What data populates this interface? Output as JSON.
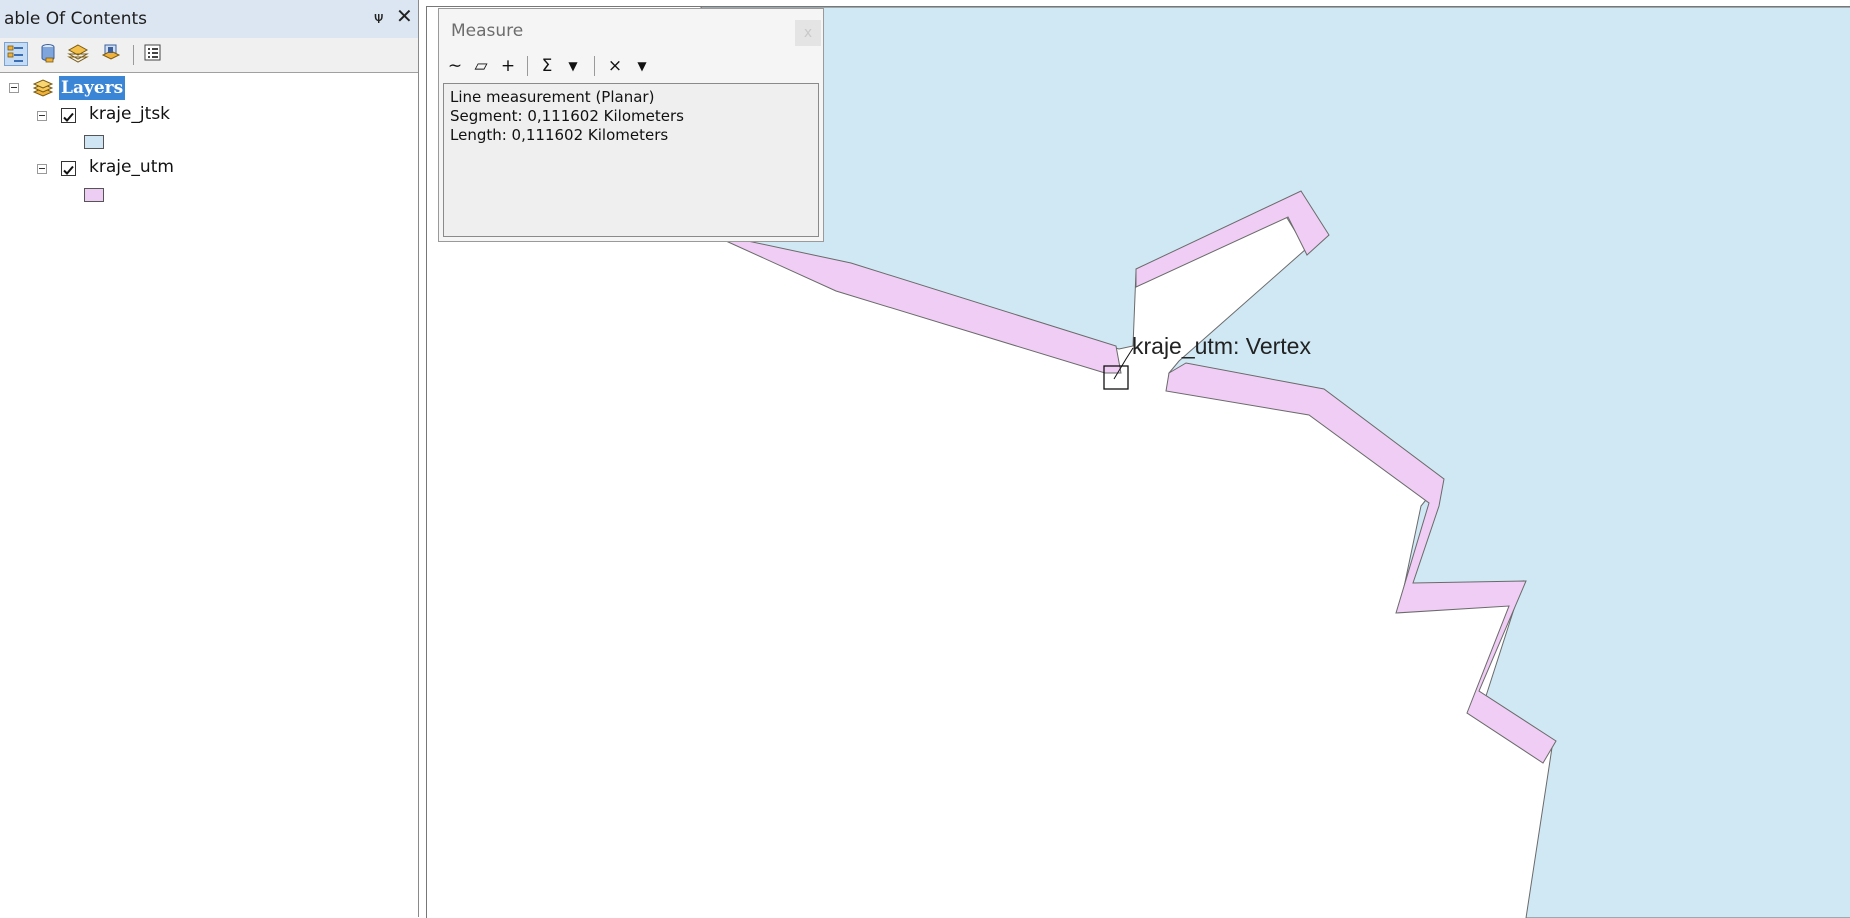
{
  "toc": {
    "title": "able Of Contents",
    "pin_glyph": "ᴪ",
    "close_glyph": "✕",
    "toolbar": {
      "buttons": [
        "list-by-drawing-order-icon",
        "list-by-source-icon",
        "list-by-visibility-icon",
        "list-by-selection-icon",
        "options-icon"
      ]
    },
    "layers_label": "Layers",
    "layers": [
      {
        "name": "kraje_jtsk",
        "checked": true,
        "swatch_color": "#cfe5f3"
      },
      {
        "name": "kraje_utm",
        "checked": true,
        "swatch_color": "#eecdf4"
      }
    ]
  },
  "measure": {
    "title": "Measure",
    "close_glyph": "x",
    "tools": {
      "line": "∼",
      "area": "▱",
      "feature": "+",
      "sum": "Σ",
      "sum_dropdown": "▼",
      "clear": "×",
      "clear_dropdown": "▼"
    },
    "results": {
      "line1": "Line measurement (Planar)",
      "line2": "Segment: 0,111602 Kilometers",
      "line3": "Length: 0,111602 Kilometers"
    }
  },
  "map": {
    "snap_label": "kraje_utm: Vertex",
    "colors": {
      "jtsk_fill": "#cfe8f4",
      "utm_fill": "#efcdf4",
      "outline": "#6a6a6a"
    }
  }
}
